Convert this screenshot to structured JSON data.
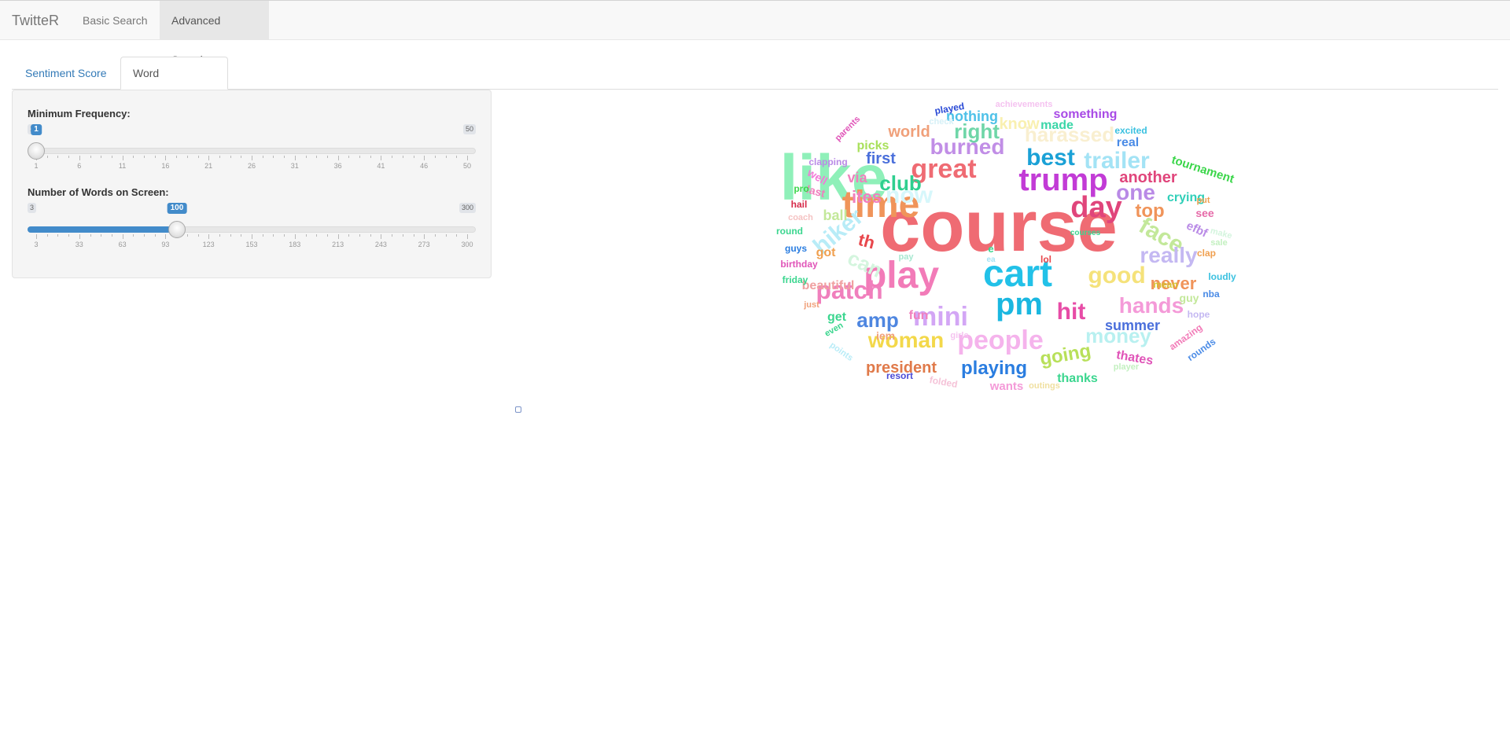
{
  "navbar": {
    "brand": "TwitteR",
    "links": [
      {
        "label": "Basic Search"
      },
      {
        "label": "Advanced Search"
      }
    ]
  },
  "tabs": [
    {
      "label": "Sentiment Score"
    },
    {
      "label": "Word Correlation"
    }
  ],
  "sidebar": {
    "min_frequency": {
      "label": "Minimum Frequency:",
      "min": 1,
      "max": 50,
      "value": 1,
      "ticks": [
        "1",
        "6",
        "11",
        "16",
        "21",
        "26",
        "31",
        "36",
        "41",
        "46",
        "50"
      ]
    },
    "num_words": {
      "label": "Number of Words on Screen:",
      "min": 3,
      "max": 300,
      "value": 100,
      "ticks": [
        "3",
        "33",
        "63",
        "93",
        "123",
        "153",
        "183",
        "213",
        "243",
        "273",
        "300"
      ]
    }
  },
  "wordcloud": {
    "words": [
      {
        "text": "course",
        "weight": 100,
        "color": "#ef6b73"
      },
      {
        "text": "like",
        "weight": 86,
        "color": "#8ff0b9"
      },
      {
        "text": "time",
        "weight": 56,
        "color": "#f0945a"
      },
      {
        "text": "play",
        "weight": 56,
        "color": "#f27bb8"
      },
      {
        "text": "cart",
        "weight": 56,
        "color": "#22c1e8"
      },
      {
        "text": "trump",
        "weight": 50,
        "color": "#c23bd6"
      },
      {
        "text": "pm",
        "weight": 48,
        "color": "#1ab7e0"
      },
      {
        "text": "day",
        "weight": 44,
        "color": "#e0457b"
      },
      {
        "text": "great",
        "weight": 42,
        "color": "#ef6b73"
      },
      {
        "text": "mini",
        "weight": 42,
        "color": "#d3a6f5"
      },
      {
        "text": "best",
        "weight": 38,
        "color": "#1aa1d6"
      },
      {
        "text": "trailer",
        "weight": 38,
        "color": "#a3e3f5"
      },
      {
        "text": "now",
        "weight": 38,
        "color": "#d6f7fb"
      },
      {
        "text": "hiker",
        "weight": 36,
        "color": "#b8ecf7"
      },
      {
        "text": "people",
        "weight": 38,
        "color": "#f5b3ec"
      },
      {
        "text": "patch",
        "weight": 36,
        "color": "#f07fbd"
      },
      {
        "text": "good",
        "weight": 36,
        "color": "#f5e27a"
      },
      {
        "text": "hit",
        "weight": 36,
        "color": "#e74ca6"
      },
      {
        "text": "face",
        "weight": 34,
        "color": "#c3e89a"
      },
      {
        "text": "one",
        "weight": 32,
        "color": "#b98ae6"
      },
      {
        "text": "club",
        "weight": 30,
        "color": "#2fcf8f"
      },
      {
        "text": "burned",
        "weight": 30,
        "color": "#c18ee6"
      },
      {
        "text": "harassed",
        "weight": 30,
        "color": "#f9efd0"
      },
      {
        "text": "right",
        "weight": 30,
        "color": "#6fd6a8"
      },
      {
        "text": "woman",
        "weight": 30,
        "color": "#f3d84a"
      },
      {
        "text": "really",
        "weight": 30,
        "color": "#c4b8f2"
      },
      {
        "text": "money",
        "weight": 30,
        "color": "#b8f0f0"
      },
      {
        "text": "hands",
        "weight": 30,
        "color": "#f49ad8"
      },
      {
        "text": "can",
        "weight": 28,
        "color": "#d4f5de"
      },
      {
        "text": "amp",
        "weight": 28,
        "color": "#4e86e0"
      },
      {
        "text": "going",
        "weight": 28,
        "color": "#b8e05a"
      },
      {
        "text": "top",
        "weight": 28,
        "color": "#f0945a"
      },
      {
        "text": "playing",
        "weight": 26,
        "color": "#2a7de0"
      },
      {
        "text": "ites",
        "weight": 24,
        "color": "#f07fbd"
      },
      {
        "text": "never",
        "weight": 24,
        "color": "#f0945a"
      },
      {
        "text": "president",
        "weight": 22,
        "color": "#e07a4a"
      },
      {
        "text": "th",
        "weight": 24,
        "color": "#e8474c"
      },
      {
        "text": "another",
        "weight": 22,
        "color": "#e0457b"
      },
      {
        "text": "first",
        "weight": 22,
        "color": "#4a6fdb"
      },
      {
        "text": "world",
        "weight": 22,
        "color": "#f0a07a"
      },
      {
        "text": "know",
        "weight": 22,
        "color": "#f9f0b0"
      },
      {
        "text": "summer",
        "weight": 20,
        "color": "#4a6fdb"
      },
      {
        "text": "nothing",
        "weight": 20,
        "color": "#4ec1e8"
      },
      {
        "text": "something",
        "weight": 18,
        "color": "#a84ae6"
      },
      {
        "text": "via",
        "weight": 20,
        "color": "#f07fbd"
      },
      {
        "text": "ball",
        "weight": 20,
        "color": "#c3e89a"
      },
      {
        "text": "crying",
        "weight": 18,
        "color": "#2fcfb8"
      },
      {
        "text": "tournament",
        "weight": 16,
        "color": "#3bd64a"
      },
      {
        "text": "thanks",
        "weight": 18,
        "color": "#3bd68f"
      },
      {
        "text": "thates",
        "weight": 18,
        "color": "#e054b8"
      },
      {
        "text": "made",
        "weight": 18,
        "color": "#3bd6a8"
      },
      {
        "text": "real",
        "weight": 18,
        "color": "#4a8be6"
      },
      {
        "text": "picks",
        "weight": 18,
        "color": "#a8e05a"
      },
      {
        "text": "beautiful",
        "weight": 18,
        "color": "#f0a0a0"
      },
      {
        "text": "fun",
        "weight": 18,
        "color": "#f07fbd"
      },
      {
        "text": "get",
        "weight": 18,
        "color": "#3bd68f"
      },
      {
        "text": "got",
        "weight": 18,
        "color": "#f0a050"
      },
      {
        "text": "efbf",
        "weight": 18,
        "color": "#b98ae6"
      },
      {
        "text": "see",
        "weight": 18,
        "color": "#e66aa8"
      },
      {
        "text": "wants",
        "weight": 18,
        "color": "#f49ad8"
      },
      {
        "text": "well",
        "weight": 16,
        "color": "#f27bd8"
      },
      {
        "text": "last",
        "weight": 16,
        "color": "#f07fbd"
      },
      {
        "text": "iem",
        "weight": 16,
        "color": "#f0a07a"
      },
      {
        "text": "guy",
        "weight": 16,
        "color": "#c3e89a"
      },
      {
        "text": "hope",
        "weight": 14,
        "color": "#c4b8f2"
      },
      {
        "text": "nba",
        "weight": 14,
        "color": "#4a8be6"
      },
      {
        "text": "loudly",
        "weight": 14,
        "color": "#3bc1e0"
      },
      {
        "text": "rounds",
        "weight": 14,
        "color": "#4a8be6"
      },
      {
        "text": "amazing",
        "weight": 14,
        "color": "#f27bb8"
      },
      {
        "text": "mean",
        "weight": 14,
        "color": "#d6c030"
      },
      {
        "text": "clap",
        "weight": 14,
        "color": "#f0a050"
      },
      {
        "text": "sale",
        "weight": 13,
        "color": "#c3f0c0"
      },
      {
        "text": "make",
        "weight": 13,
        "color": "#d4f5de"
      },
      {
        "text": "put",
        "weight": 13,
        "color": "#f0a050"
      },
      {
        "text": "excited",
        "weight": 14,
        "color": "#3bc1e0"
      },
      {
        "text": "achievements",
        "weight": 13,
        "color": "#f5c3f0"
      },
      {
        "text": "played",
        "weight": 14,
        "color": "#2a4ad6"
      },
      {
        "text": "check",
        "weight": 13,
        "color": "#d6f0f7"
      },
      {
        "text": "parents",
        "weight": 13,
        "color": "#e054b8"
      },
      {
        "text": "clapping",
        "weight": 14,
        "color": "#b98ae6"
      },
      {
        "text": "pro",
        "weight": 14,
        "color": "#3bd64a"
      },
      {
        "text": "hail",
        "weight": 14,
        "color": "#d62a4a"
      },
      {
        "text": "coach",
        "weight": 13,
        "color": "#f5c3c3"
      },
      {
        "text": "round",
        "weight": 14,
        "color": "#3bd68f"
      },
      {
        "text": "guys",
        "weight": 14,
        "color": "#2a7de0"
      },
      {
        "text": "birthday",
        "weight": 14,
        "color": "#e054b8"
      },
      {
        "text": "friday",
        "weight": 14,
        "color": "#3bd68f"
      },
      {
        "text": "just",
        "weight": 13,
        "color": "#f0a07a"
      },
      {
        "text": "even",
        "weight": 13,
        "color": "#3bd68f"
      },
      {
        "text": "points",
        "weight": 13,
        "color": "#b8ecf7"
      },
      {
        "text": "resort",
        "weight": 14,
        "color": "#4a4ad6"
      },
      {
        "text": "folded",
        "weight": 14,
        "color": "#f5c3d8"
      },
      {
        "text": "outings",
        "weight": 13,
        "color": "#f0e0a0"
      },
      {
        "text": "player",
        "weight": 13,
        "color": "#c3f0c0"
      },
      {
        "text": "girls",
        "weight": 13,
        "color": "#f5c3f0"
      },
      {
        "text": "pay",
        "weight": 13,
        "color": "#a8e8d0"
      },
      {
        "text": "lol",
        "weight": 14,
        "color": "#e8474c"
      },
      {
        "text": "courses",
        "weight": 12,
        "color": "#3bd68f"
      },
      {
        "text": "e",
        "weight": 14,
        "color": "#3bd68f"
      },
      {
        "text": "ea",
        "weight": 12,
        "color": "#a3e3f5"
      }
    ]
  }
}
